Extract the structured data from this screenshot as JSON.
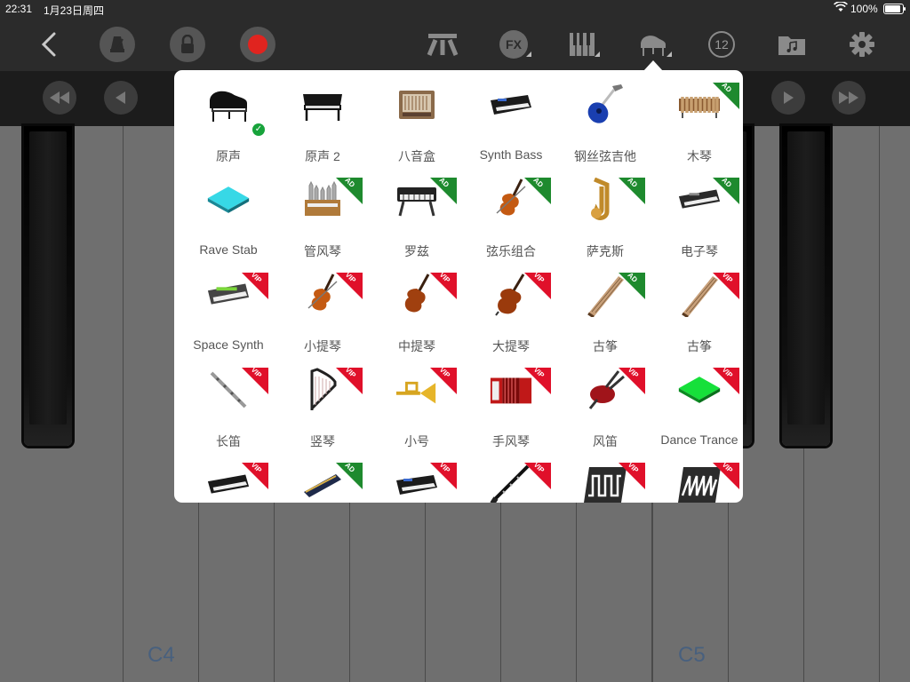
{
  "status_bar": {
    "time": "22:31",
    "date": "1月23日周四",
    "battery": "100%"
  },
  "toolbar": {
    "buttons": [
      "back-icon",
      "metronome-icon",
      "lock-icon",
      "record-icon",
      "chord-icon",
      "fx-icon",
      "keyboard-icon",
      "grand-piano-icon",
      "number-12-icon",
      "song-folder-icon",
      "gear-icon"
    ],
    "fx_label": "FX",
    "number_label": "12"
  },
  "transport": {
    "buttons": [
      "rewind-icon",
      "prev-icon",
      "next-icon",
      "fast-forward-icon"
    ]
  },
  "piano": {
    "labels": {
      "c4": "C4",
      "c5": "C5"
    }
  },
  "instrument_picker": {
    "selected": "原声",
    "rows": [
      [
        {
          "name": "原声",
          "icon": "grand-piano-icon",
          "badge": "",
          "selected": true
        },
        {
          "name": "原声 2",
          "icon": "grand-piano-2-icon",
          "badge": ""
        },
        {
          "name": "八音盒",
          "icon": "music-box-icon",
          "badge": ""
        },
        {
          "name": "Synth Bass",
          "icon": "synth-keyboard-icon",
          "badge": ""
        },
        {
          "name": "钢丝弦吉他",
          "icon": "acoustic-guitar-icon",
          "badge": ""
        },
        {
          "name": "木琴",
          "icon": "xylophone-icon",
          "badge": "AD"
        }
      ],
      [
        {
          "name": "Rave Stab",
          "icon": "cyan-pad-icon",
          "badge": ""
        },
        {
          "name": "管风琴",
          "icon": "pipe-organ-icon",
          "badge": "AD"
        },
        {
          "name": "罗兹",
          "icon": "rhodes-icon",
          "badge": "AD"
        },
        {
          "name": "弦乐组合",
          "icon": "violin-icon",
          "badge": "AD"
        },
        {
          "name": "萨克斯",
          "icon": "saxophone-icon",
          "badge": "AD"
        },
        {
          "name": "电子琴",
          "icon": "electronic-keyboard-icon",
          "badge": "AD"
        }
      ],
      [
        {
          "name": "Space Synth",
          "icon": "space-synth-icon",
          "badge": "VIP"
        },
        {
          "name": "小提琴",
          "icon": "violin-icon",
          "badge": "VIP"
        },
        {
          "name": "中提琴",
          "icon": "viola-icon",
          "badge": "VIP"
        },
        {
          "name": "大提琴",
          "icon": "cello-icon",
          "badge": "VIP"
        },
        {
          "name": "古筝",
          "icon": "guzheng-icon",
          "badge": "AD"
        },
        {
          "name": "古筝",
          "icon": "guzheng-icon",
          "badge": "VIP"
        }
      ],
      [
        {
          "name": "长笛",
          "icon": "flute-icon",
          "badge": "VIP"
        },
        {
          "name": "竖琴",
          "icon": "harp-icon",
          "badge": "VIP"
        },
        {
          "name": "小号",
          "icon": "trumpet-icon",
          "badge": "VIP"
        },
        {
          "name": "手风琴",
          "icon": "accordion-icon",
          "badge": "VIP"
        },
        {
          "name": "风笛",
          "icon": "bagpipe-icon",
          "badge": "VIP"
        },
        {
          "name": "Dance Trance",
          "icon": "green-pad-icon",
          "badge": "VIP"
        }
      ],
      [
        {
          "name": "",
          "icon": "keyboard-icon",
          "badge": "VIP"
        },
        {
          "name": "",
          "icon": "harmonica-icon",
          "badge": "AD"
        },
        {
          "name": "",
          "icon": "synth-keyboard-icon",
          "badge": "VIP"
        },
        {
          "name": "",
          "icon": "clarinet-icon",
          "badge": "VIP"
        },
        {
          "name": "",
          "icon": "square-wave-icon",
          "badge": "VIP"
        },
        {
          "name": "",
          "icon": "sawtooth-wave-icon",
          "badge": "VIP"
        }
      ]
    ]
  },
  "colors": {
    "vip_badge": "#e0102a",
    "ad_badge": "#1e8a2e",
    "selected_check": "#17a33b",
    "record": "#e0241f"
  }
}
